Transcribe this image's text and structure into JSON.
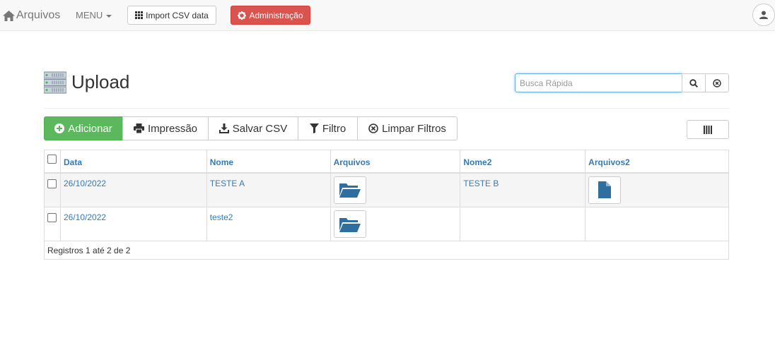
{
  "navbar": {
    "brand": "Arquivos",
    "menu": "MENU",
    "import_label": "Import CSV data",
    "admin_label": "Administração",
    "admin_color": "#d9534f"
  },
  "page": {
    "title": "Upload",
    "search_placeholder": "Busca Rápida"
  },
  "toolbar": {
    "add": "Adicionar",
    "print": "Impressão",
    "save_csv": "Salvar CSV",
    "filter": "Filtro",
    "clear_filters": "Limpar Filtros",
    "accent": "#5cb85c"
  },
  "table": {
    "columns": [
      "Data",
      "Nome",
      "Arquivos",
      "Nome2",
      "Arquivos2"
    ],
    "rows": [
      {
        "data": "26/10/2022",
        "nome": "TESTE A",
        "arquivos": "folder-open-icon",
        "nome2": "TESTE B",
        "arquivos2": "file-icon"
      },
      {
        "data": "26/10/2022",
        "nome": "teste2",
        "arquivos": "folder-open-icon",
        "nome2": "",
        "arquivos2": ""
      }
    ],
    "footer": "Registros 1 até 2 de 2"
  }
}
